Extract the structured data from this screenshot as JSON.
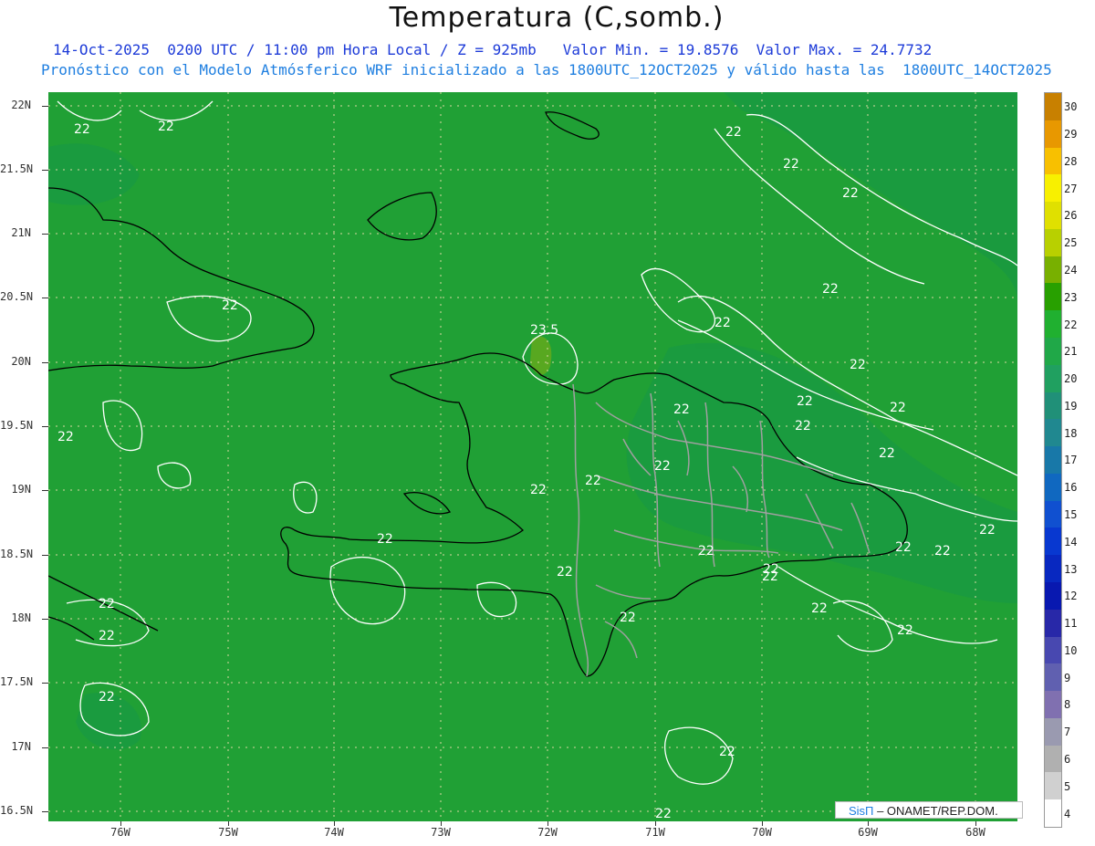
{
  "header": {
    "title": "Temperatura (C,somb.)",
    "subtitle_line1": "14-Oct-2025  0200 UTC / 11:00 pm Hora Local / Z = 925mb   Valor Min. = 19.8576  Valor Max. = 24.7732",
    "subtitle_line2": "Pronóstico con el Modelo Atmósferico WRF inicializado a las 1800UTC_12OCT2025 y válido hasta las  1800UTC_14OCT2025"
  },
  "map": {
    "lat_labels": [
      "22N",
      "21.5N",
      "21N",
      "20.5N",
      "20N",
      "19.5N",
      "19N",
      "18.5N",
      "18N",
      "17.5N",
      "17N",
      "16.5N"
    ],
    "lon_labels": [
      "76W",
      "75W",
      "74W",
      "73W",
      "72W",
      "71W",
      "70W",
      "69W",
      "68W"
    ],
    "contour_labels": [
      "22",
      "22",
      "22",
      "22",
      "22",
      "22",
      "22",
      "22",
      "22",
      "22",
      "22",
      "22",
      "22",
      "22",
      "22",
      "22",
      "22",
      "22",
      "22",
      "22",
      "22",
      "22",
      "22",
      "22",
      "22",
      "22",
      "23.5"
    ],
    "background_color": "#20a035"
  },
  "colorbar": {
    "labels": [
      "30",
      "29",
      "28",
      "27",
      "26",
      "25",
      "24",
      "23",
      "22",
      "21",
      "20",
      "19",
      "18",
      "17",
      "16",
      "15",
      "14",
      "13",
      "12",
      "11",
      "10",
      "9",
      "8",
      "7",
      "6",
      "5",
      "4"
    ],
    "colors": [
      "#c88000",
      "#e89800",
      "#f8c000",
      "#f8f000",
      "#e0e000",
      "#b8d000",
      "#78b000",
      "#28a000",
      "#20b030",
      "#20a848",
      "#20a060",
      "#209078",
      "#208890",
      "#1878a8",
      "#1068c0",
      "#1050d0",
      "#0838d0",
      "#0828c0",
      "#0818b0",
      "#2828a8",
      "#4848b0",
      "#6060b0",
      "#8070b0",
      "#9a9ab0",
      "#b0b0b0",
      "#d0d0d0",
      "#ffffff"
    ]
  },
  "credit": {
    "brand": "SisΠ",
    "text": " –  ONAMET/REP.DOM."
  }
}
